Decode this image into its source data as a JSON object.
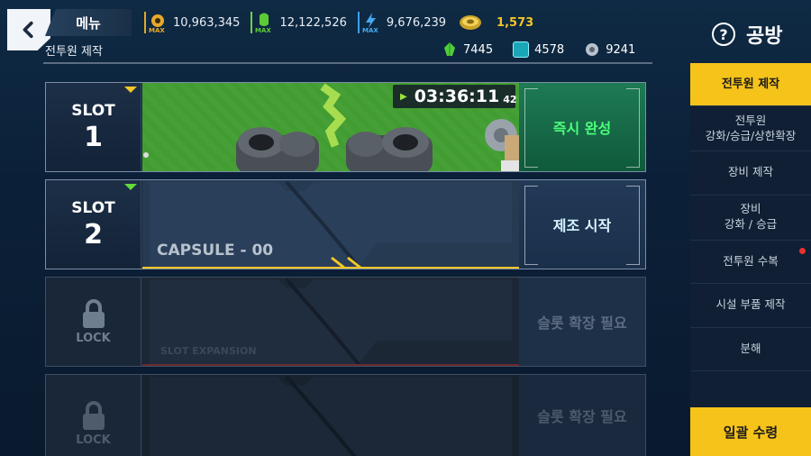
{
  "header": {
    "menu_label": "메뉴",
    "subtitle": "전투원 제작",
    "title": "공방",
    "help": "?"
  },
  "resources": [
    {
      "icon": "gear-max-icon",
      "badge": "MAX",
      "value": "10,963,345"
    },
    {
      "icon": "green-max-icon",
      "badge": "MAX",
      "value": "12,122,526"
    },
    {
      "icon": "energy-max-icon",
      "badge": "MAX",
      "value": "9,676,239"
    },
    {
      "icon": "gold-coin-icon",
      "value": "1,573"
    }
  ],
  "materials": [
    {
      "icon": "green-crystal-icon",
      "value": "7445"
    },
    {
      "icon": "cyan-cube-icon",
      "value": "4578"
    },
    {
      "icon": "silver-part-icon",
      "value": "9241"
    }
  ],
  "slots": [
    {
      "word": "SLOT",
      "number": "1",
      "timer": "03:36:11",
      "timer_ms": "42",
      "action": "즉시 완성"
    },
    {
      "word": "SLOT",
      "number": "2",
      "capsule": "CAPSULE - 00",
      "action": "제조 시작"
    },
    {
      "lock": "LOCK",
      "expansion": "SLOT EXPANSION",
      "action": "슬롯 확장 필요"
    },
    {
      "lock": "LOCK",
      "action": "슬롯 확장 필요"
    }
  ],
  "sidebar": {
    "items": [
      {
        "label": "전투원 제작"
      },
      {
        "label": "전투원\n강화/승급/상한확장"
      },
      {
        "label": "장비 제작"
      },
      {
        "label": "장비\n강화 / 승급"
      },
      {
        "label": "전투원 수복"
      },
      {
        "label": "시설 부품 제작"
      },
      {
        "label": "분해"
      }
    ],
    "collect_all": "일괄 수령"
  },
  "colors": {
    "accent": "#f6c31b",
    "instant": "#4cff7a",
    "alert": "#e8322f"
  }
}
